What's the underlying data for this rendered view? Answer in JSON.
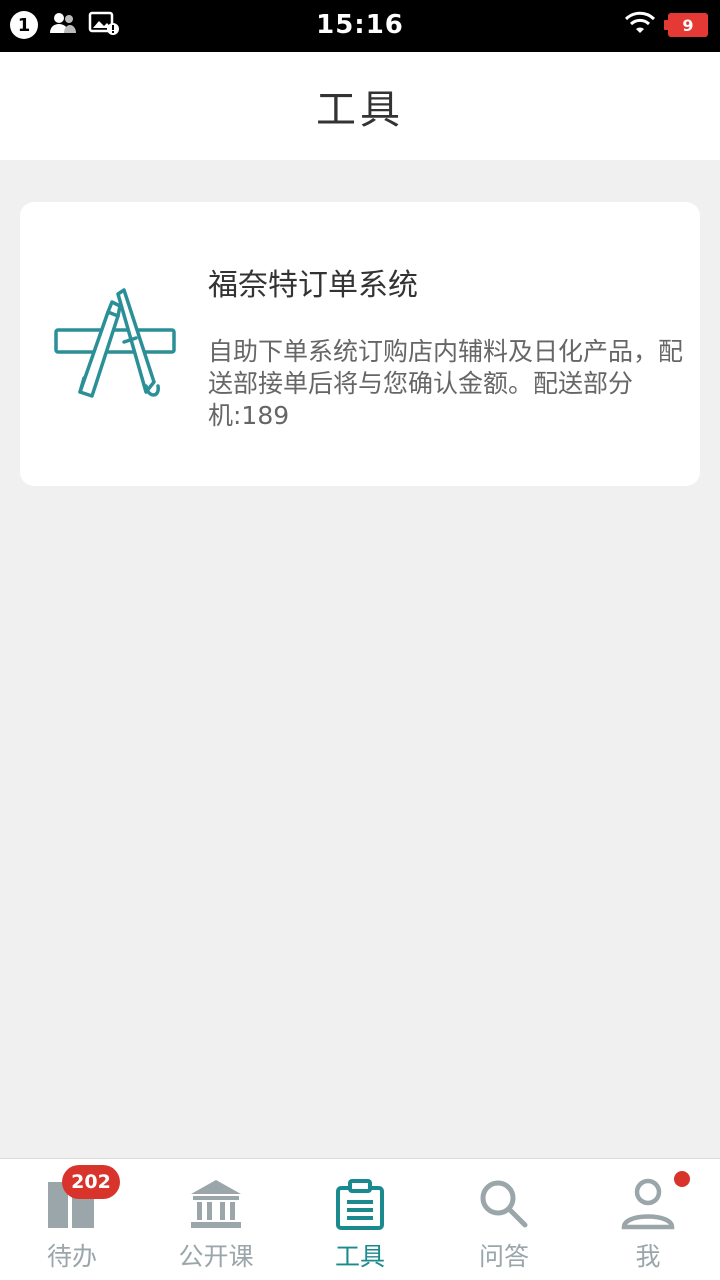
{
  "status_bar": {
    "notification_count": "1",
    "time": "15:16",
    "battery": "9"
  },
  "header": {
    "title": "工具"
  },
  "tools": [
    {
      "title": "福奈特订单系统",
      "description": "自助下单系统订购店内辅料及日化产品，配送部接单后将与您确认金额。配送部分机:189",
      "icon": "app-store-pencil-brush-icon"
    }
  ],
  "tabbar": {
    "items": [
      {
        "label": "待办",
        "icon": "todo-icon",
        "badge": "202"
      },
      {
        "label": "公开课",
        "icon": "institution-icon"
      },
      {
        "label": "工具",
        "icon": "clipboard-icon",
        "active": true
      },
      {
        "label": "问答",
        "icon": "search-icon"
      },
      {
        "label": "我",
        "icon": "person-icon",
        "has_dot": true
      }
    ]
  },
  "colors": {
    "accent": "#1a8a8e",
    "inactive": "#9aa6a9",
    "badge": "#d8342c",
    "background": "#f0f0f0"
  }
}
